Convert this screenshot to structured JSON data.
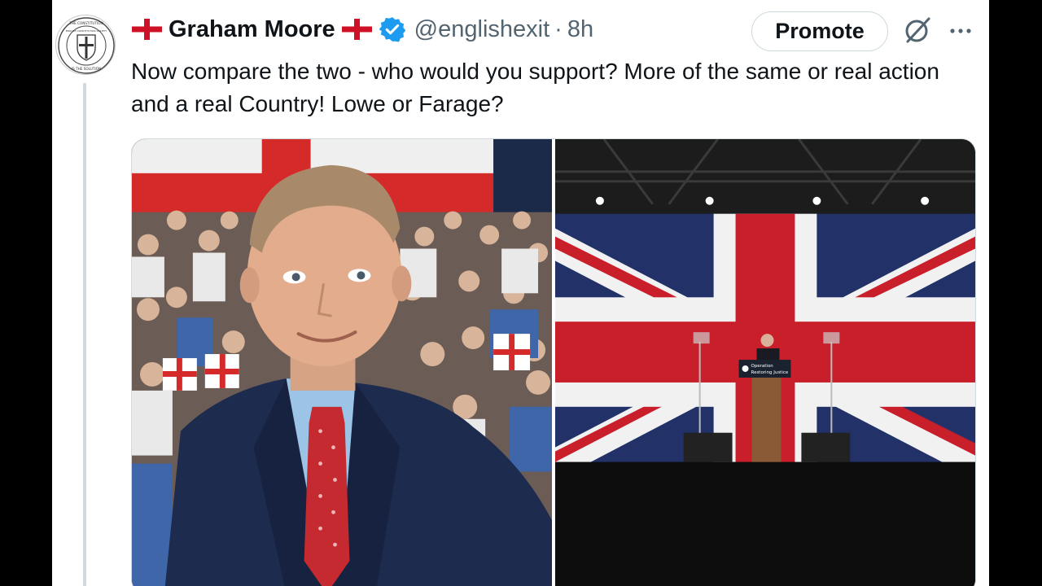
{
  "tweet": {
    "author": {
      "display_name": "Graham Moore",
      "handle": "@englishexit",
      "time": "8h",
      "verified": true,
      "name_flag_icon": "england-flag-icon",
      "avatar_logo_text": [
        "THE CONSTITUTION",
        "ENGLISH CONSTITUTION SOCIETY",
        "IS THE SOLUTION"
      ]
    },
    "promote_label": "Promote",
    "text": "Now compare the two - who would you support? More of the same or real action and a real Country! Lowe or Farage?",
    "media": [
      {
        "name": "photo-man-with-crowd",
        "description_icon": "portrait-photo"
      },
      {
        "name": "photo-speaker-at-podium",
        "podium_sign": [
          "Operation",
          "Restoring Justice"
        ]
      }
    ]
  },
  "colors": {
    "text_primary": "#0f1419",
    "text_secondary": "#536471",
    "verified_blue": "#1d9bf0",
    "border": "#cfd9de",
    "page_background": "#000000"
  }
}
